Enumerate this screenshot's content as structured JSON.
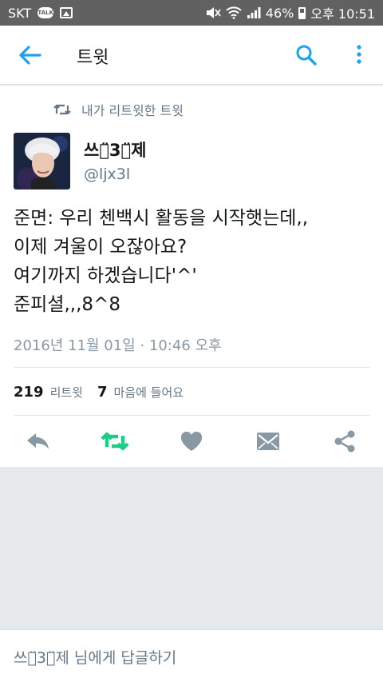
{
  "status_bar": {
    "carrier": "SKT",
    "talk_badge": "TALK",
    "battery": "46%",
    "time": "오후 10:51"
  },
  "header": {
    "title": "트윗",
    "icons": [
      "back-arrow-icon",
      "search-icon",
      "more-vertical-icon"
    ],
    "accent_color": "#1da1f2"
  },
  "tweet": {
    "retweet_label": "내가 리트윗한 트윗",
    "author": {
      "display_name": "쓰ᄋ̈3ᄋ̈제",
      "handle": "@ljx3l"
    },
    "text_lines": [
      "준면: 우리 첸백시 활동을 시작햇는데,,",
      "이제 겨울이 오잖아요?",
      "여기까지 하겠습니다'^'",
      "준피셜,,,8^8"
    ],
    "timestamp": "2016년 11월 01일 · 10:46 오후",
    "retweet_count": "219",
    "retweet_count_label": "리트윗",
    "like_count": "7",
    "like_count_label": "마음에 들어요",
    "actions": [
      "reply-icon",
      "retweet-icon",
      "like-icon",
      "dm-icon",
      "share-icon"
    ],
    "retweet_active_color": "#19cf86"
  },
  "reply_bar": {
    "placeholder": "쓰ᄋ̈3ᄋ̈제 님에게 답글하기"
  }
}
